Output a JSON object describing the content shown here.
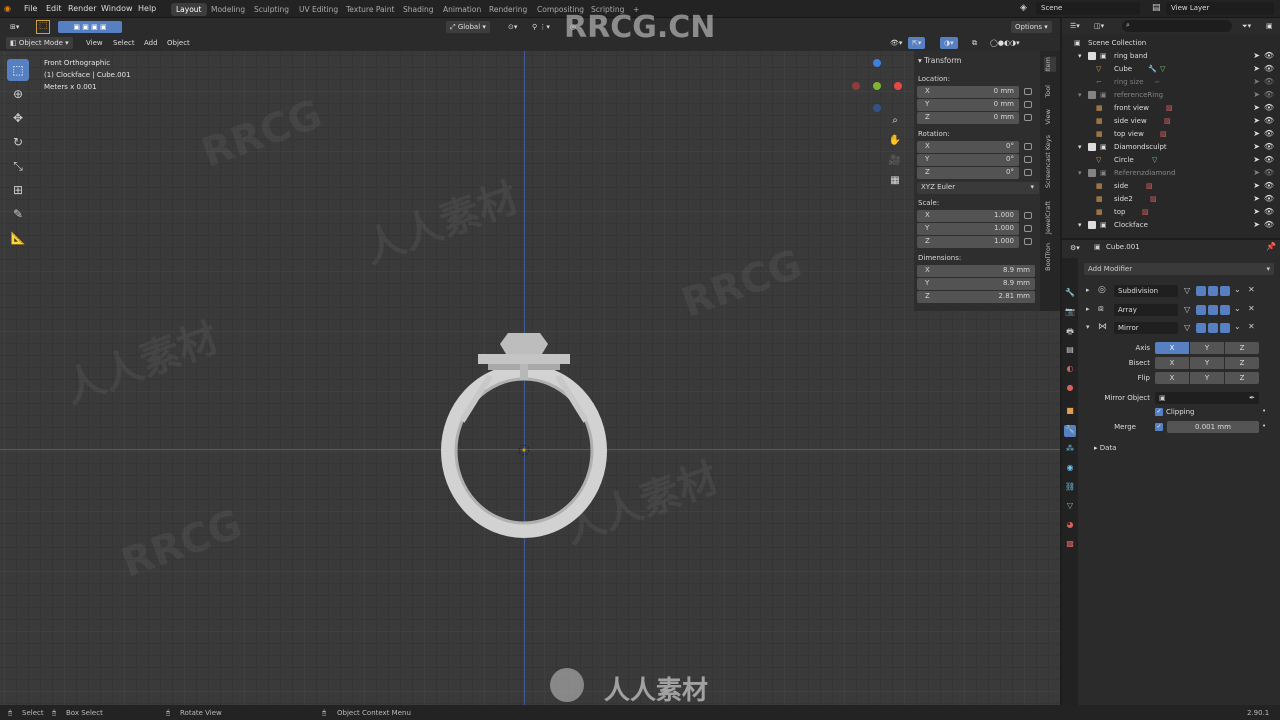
{
  "topbar": {
    "menus": [
      "File",
      "Edit",
      "Render",
      "Window",
      "Help"
    ],
    "workspaces": [
      "Layout",
      "Modeling",
      "Sculpting",
      "UV Editing",
      "Texture Paint",
      "Shading",
      "Animation",
      "Rendering",
      "Compositing",
      "Scripting",
      "+"
    ],
    "scene": "Scene",
    "view_layer": "View Layer"
  },
  "viewport_header": {
    "orientation": "Global",
    "mode": "Object Mode",
    "menus": [
      "View",
      "Select",
      "Add",
      "Object"
    ],
    "options": "Options"
  },
  "viewport": {
    "view_name": "Front Orthographic",
    "object_line": "(1) Clockface | Cube.001",
    "units": "Meters x 0.001"
  },
  "npanel": {
    "title": "Transform",
    "location_label": "Location:",
    "location": [
      {
        "axis": "X",
        "value": "0 mm"
      },
      {
        "axis": "Y",
        "value": "0 mm"
      },
      {
        "axis": "Z",
        "value": "0 mm"
      }
    ],
    "rotation_label": "Rotation:",
    "rotation": [
      {
        "axis": "X",
        "value": "0°"
      },
      {
        "axis": "Y",
        "value": "0°"
      },
      {
        "axis": "Z",
        "value": "0°"
      }
    ],
    "rotation_mode": "XYZ Euler",
    "scale_label": "Scale:",
    "scale": [
      {
        "axis": "X",
        "value": "1.000"
      },
      {
        "axis": "Y",
        "value": "1.000"
      },
      {
        "axis": "Z",
        "value": "1.000"
      }
    ],
    "dimensions_label": "Dimensions:",
    "dimensions": [
      {
        "axis": "X",
        "value": "8.9 mm"
      },
      {
        "axis": "Y",
        "value": "8.9 mm"
      },
      {
        "axis": "Z",
        "value": "2.81 mm"
      }
    ],
    "side_tabs": [
      "Item",
      "Tool",
      "View",
      "Screencast Keys",
      "JewelCraft",
      "BoolTron"
    ]
  },
  "outliner": {
    "search_placeholder": "",
    "root": "Scene Collection",
    "rows": [
      "ring band",
      "Cube",
      "ring size",
      "referenceRing",
      "front view",
      "side view",
      "top view",
      "Diamondsculpt",
      "Circle",
      "Referenzdiamond",
      "side",
      "side2",
      "top",
      "Clockface"
    ]
  },
  "properties": {
    "object_name": "Cube.001",
    "add_modifier": "Add Modifier",
    "modifiers": [
      "Subdivision",
      "Array",
      "Mirror"
    ],
    "axis_label": "Axis",
    "bisect_label": "Bisect",
    "flip_label": "Flip",
    "xyz": [
      "X",
      "Y",
      "Z"
    ],
    "mirror_object_label": "Mirror Object",
    "clipping_label": "Clipping",
    "merge_label": "Merge",
    "merge_value": "0.001 mm",
    "data_label": "Data"
  },
  "status": {
    "select": "Select",
    "box_select": "Box Select",
    "rotate_view": "Rotate View",
    "context_menu": "Object Context Menu",
    "version": "2.90.1"
  },
  "watermark": {
    "top": "RRCG.CN",
    "bottom": "人人素材"
  },
  "colors": {
    "accent": "#5680c2",
    "x_axis": "#e8474e",
    "y_axis": "#7fb52d",
    "z_axis": "#3f7fe0"
  }
}
